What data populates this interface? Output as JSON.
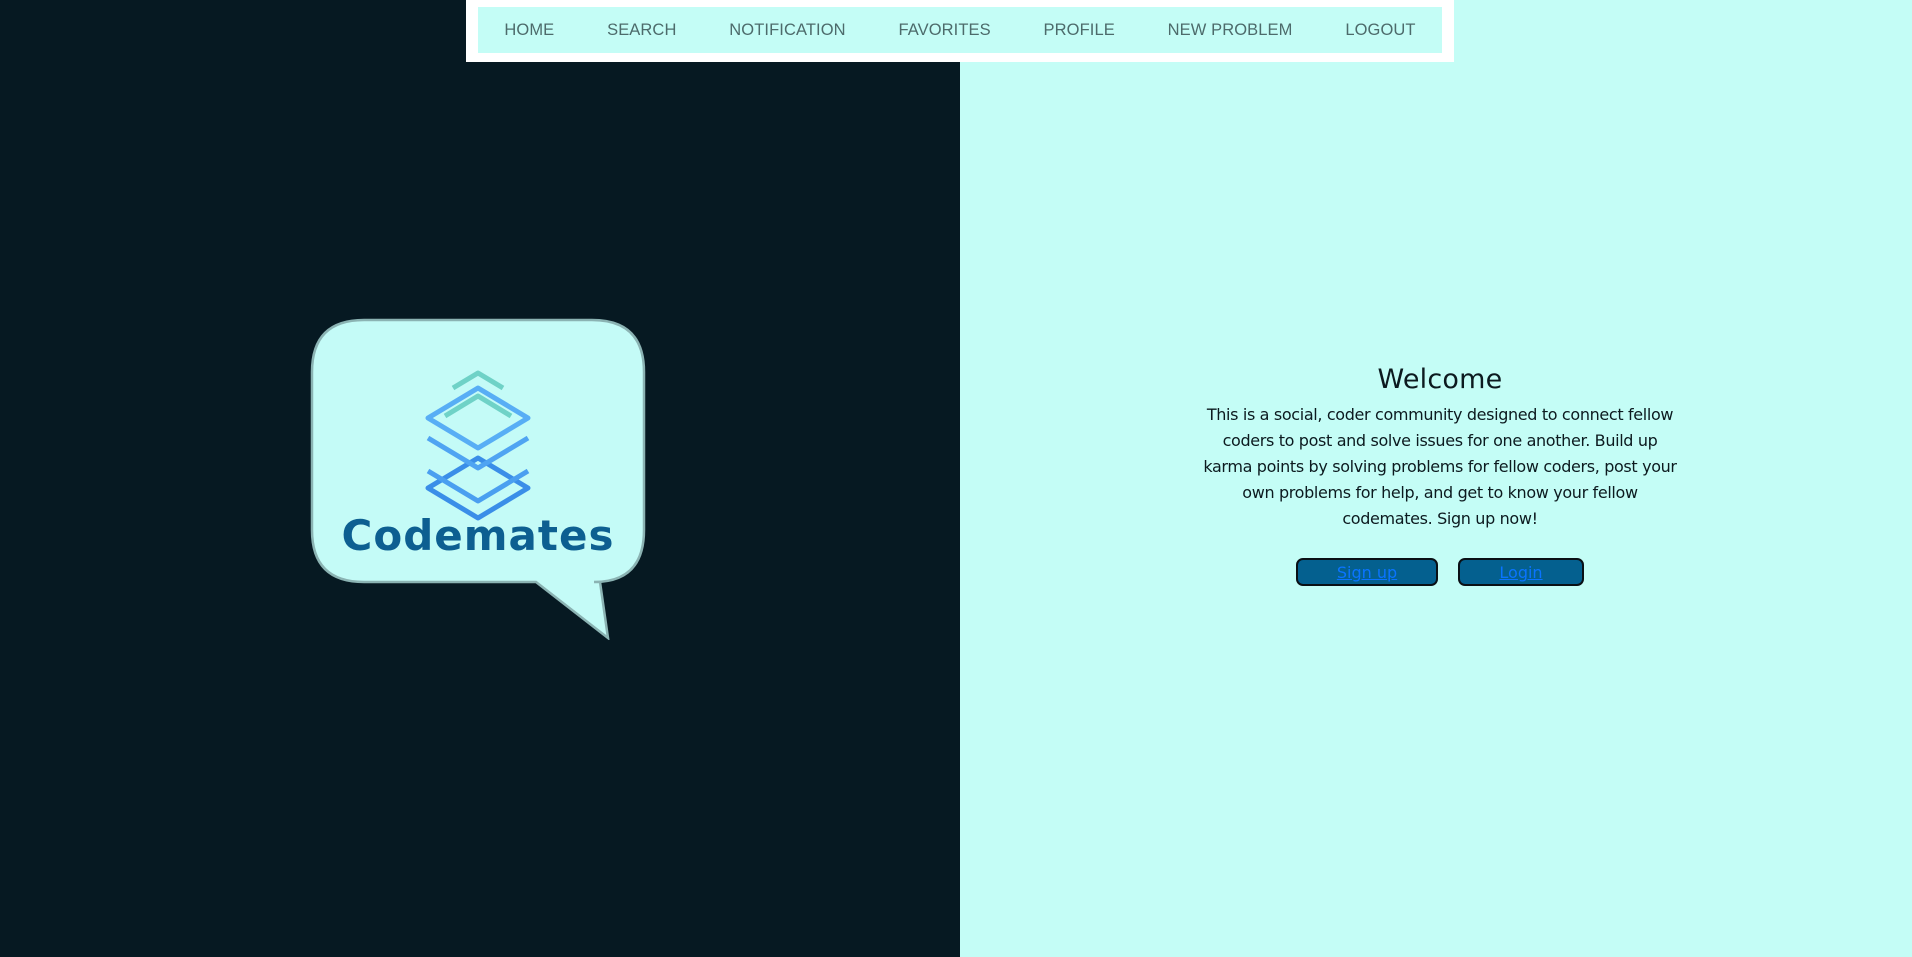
{
  "nav": {
    "items": [
      {
        "label": "HOME"
      },
      {
        "label": "SEARCH"
      },
      {
        "label": "NOTIFICATION"
      },
      {
        "label": "FAVORITES"
      },
      {
        "label": "PROFILE"
      },
      {
        "label": "NEW PROBLEM"
      },
      {
        "label": "LOGOUT"
      }
    ]
  },
  "logo": {
    "text": "Codemates"
  },
  "welcome": {
    "title": "Welcome",
    "body": "This is a social, coder community designed to connect fellow coders to post and solve issues for one another. Build up karma points by solving problems for fellow coders, post your own problems for help, and get to know your fellow codemates. Sign up now!",
    "signup_label": "Sign up",
    "login_label": "Login"
  },
  "colors": {
    "dark_panel": "#061922",
    "light_panel": "#c4fdf6",
    "button_bg": "#04608f",
    "link": "#0a74ff",
    "logo_text": "#0d5f91"
  }
}
